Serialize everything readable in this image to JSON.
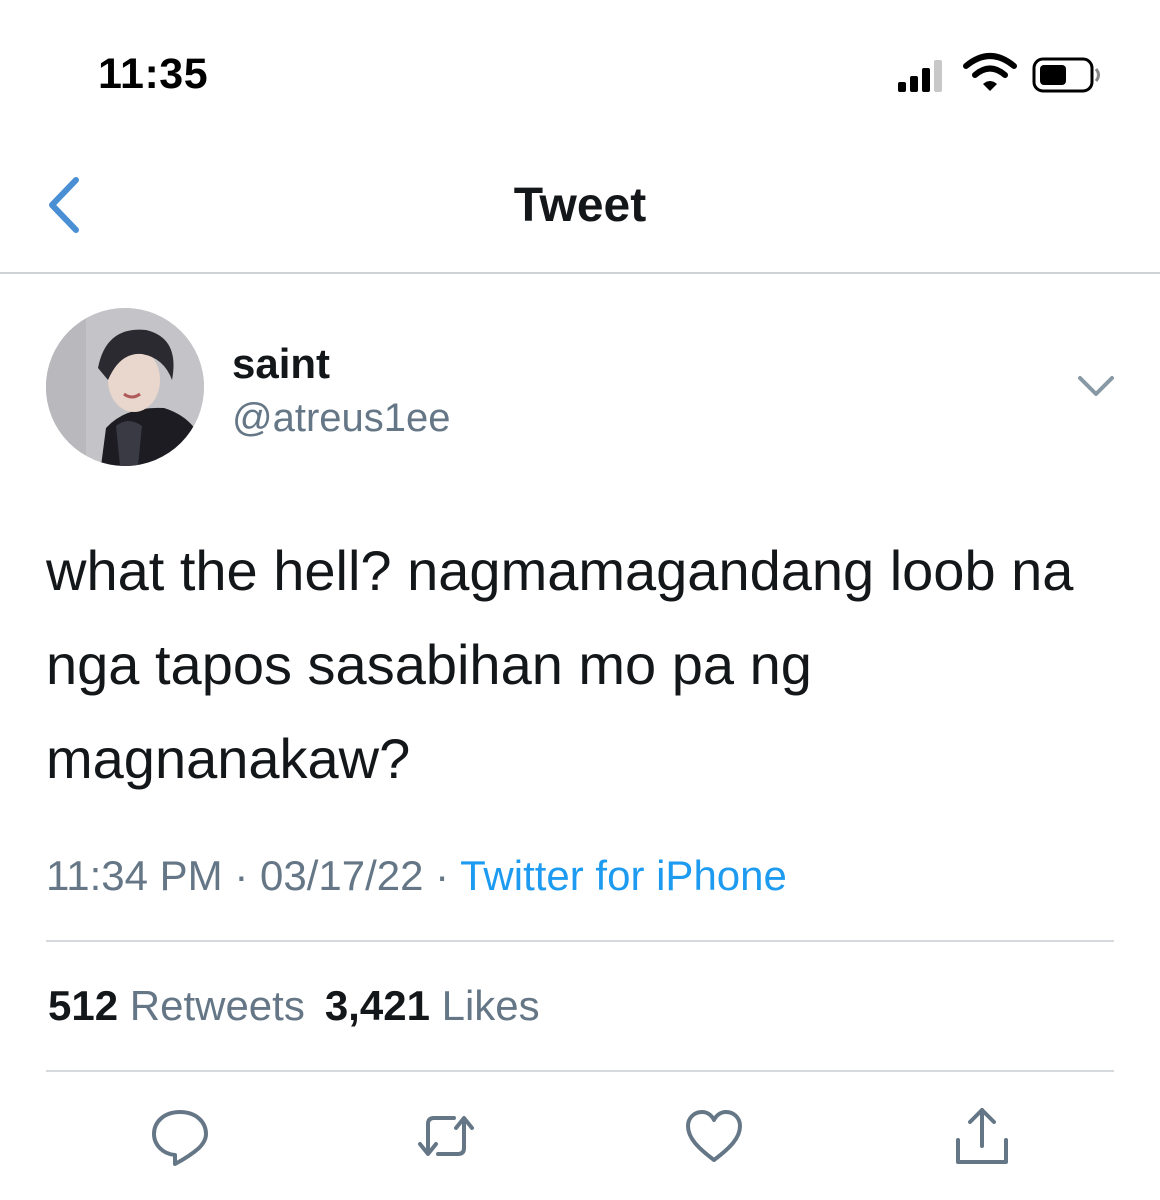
{
  "status_bar": {
    "time": "11:35"
  },
  "nav": {
    "title": "Tweet"
  },
  "tweet": {
    "display_name": "saint",
    "handle": "@atreus1ee",
    "text": "what the hell? nagmamagandang loob na nga tapos sasabihan mo pa ng magnanakaw?",
    "time": "11:34 PM",
    "separator": " · ",
    "date": "03/17/22",
    "source": "Twitter for iPhone",
    "retweets_count": "512",
    "retweets_label": "Retweets",
    "likes_count": "3,421",
    "likes_label": "Likes"
  },
  "colors": {
    "accent": "#1d9bf0",
    "back_icon": "#4a8fd4",
    "secondary_text": "#657786"
  },
  "icons": [
    "signal-icon",
    "wifi-icon",
    "battery-icon",
    "back-chevron-icon",
    "chevron-down-icon",
    "reply-icon",
    "retweet-icon",
    "like-icon",
    "share-icon"
  ]
}
